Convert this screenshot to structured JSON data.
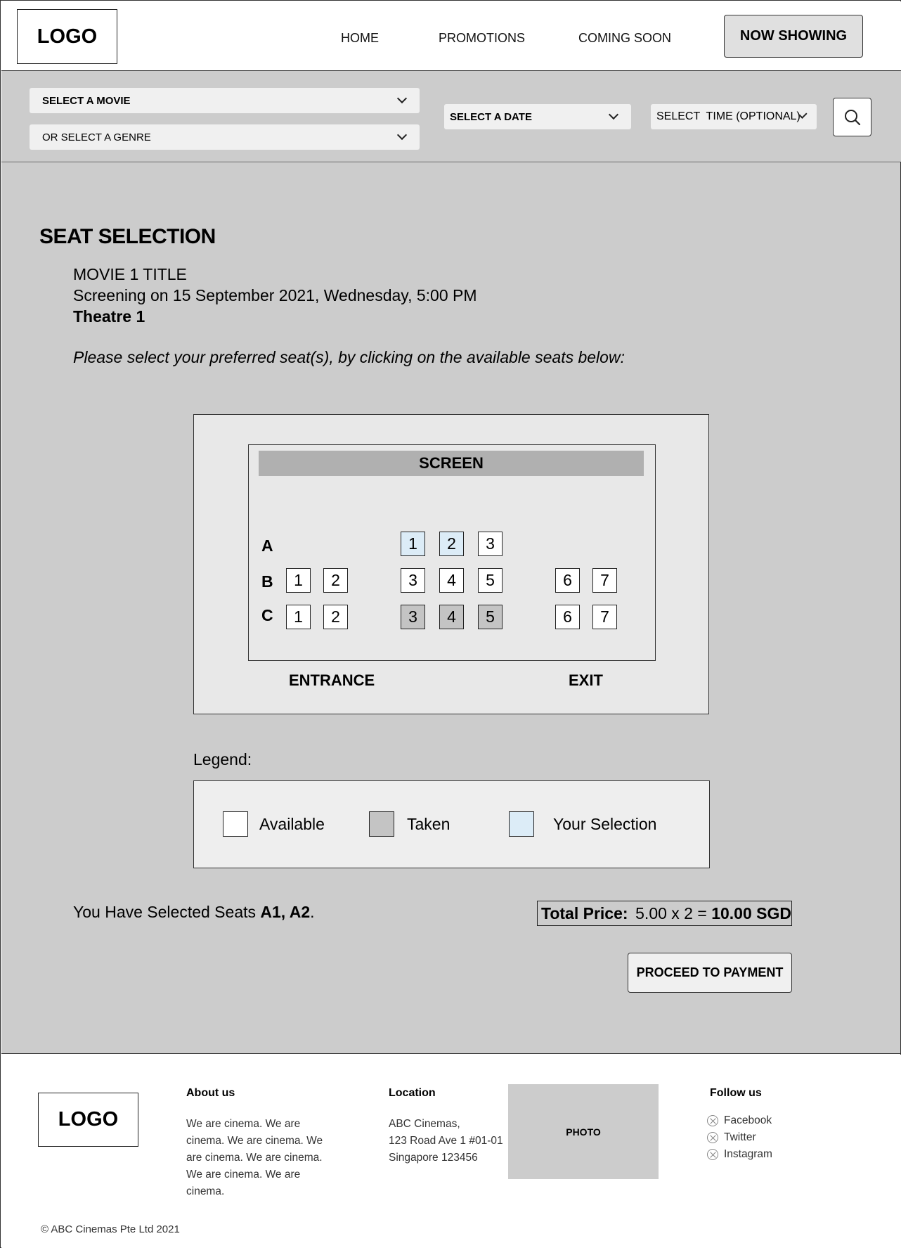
{
  "header": {
    "logo": "LOGO",
    "nav": {
      "home": "HOME",
      "promotions": "PROMOTIONS",
      "coming_soon": "COMING SOON",
      "now_showing": "NOW SHOWING"
    }
  },
  "filters": {
    "movie": "SELECT A MOVIE",
    "genre": "OR SELECT A GENRE",
    "date": "SELECT A DATE",
    "time": "SELECT  TIME (OPTIONAL)",
    "search_icon": "search-icon"
  },
  "main": {
    "title": "SEAT SELECTION",
    "movie_title": "MOVIE 1 TITLE",
    "screening": "Screening on 15 September 2021, Wednesday, 5:00 PM",
    "theatre": "Theatre 1",
    "instructions": "Please select your preferred seat(s), by clicking on the available seats below:"
  },
  "seatmap": {
    "screen": "SCREEN",
    "rows": [
      {
        "label": "A",
        "seats": [
          {
            "number": "1",
            "status": "selected"
          },
          {
            "number": "2",
            "status": "selected"
          },
          {
            "number": "3",
            "status": "available"
          }
        ]
      },
      {
        "label": "B",
        "seats": [
          {
            "number": "1",
            "status": "available"
          },
          {
            "number": "2",
            "status": "available"
          },
          {
            "number": "3",
            "status": "available"
          },
          {
            "number": "4",
            "status": "available"
          },
          {
            "number": "5",
            "status": "available"
          },
          {
            "number": "6",
            "status": "available"
          },
          {
            "number": "7",
            "status": "available"
          }
        ]
      },
      {
        "label": "C",
        "seats": [
          {
            "number": "1",
            "status": "available"
          },
          {
            "number": "2",
            "status": "available"
          },
          {
            "number": "3",
            "status": "taken"
          },
          {
            "number": "4",
            "status": "taken"
          },
          {
            "number": "5",
            "status": "taken"
          },
          {
            "number": "6",
            "status": "available"
          },
          {
            "number": "7",
            "status": "available"
          }
        ]
      }
    ],
    "entrance": "ENTRANCE",
    "exit": "EXIT"
  },
  "legend": {
    "title": "Legend:",
    "available": "Available",
    "taken": "Taken",
    "selection": "Your Selection"
  },
  "summary": {
    "selected_prefix": "You Have Selected Seats ",
    "selected_seats": "A1, A2",
    "selected_suffix": ".",
    "total_label": "Total Price:",
    "total_calc": "5.00 x 2 = ",
    "total_value": "10.00 SGD",
    "proceed": "PROCEED TO PAYMENT"
  },
  "footer": {
    "logo": "LOGO",
    "about_title": "About us",
    "about_lines": [
      "We are cinema. We are",
      "cinema. We are cinema. We",
      "are cinema. We are cinema.",
      "We are cinema. We are",
      "cinema."
    ],
    "location_title": "Location",
    "location_lines": [
      "ABC Cinemas,",
      "123 Road Ave 1 #01-01",
      "Singapore 123456"
    ],
    "photo": "PHOTO",
    "follow_title": "Follow us",
    "social": [
      "Facebook",
      "Twitter",
      "Instagram"
    ],
    "copyright": "© ABC Cinemas Pte Ltd 2021"
  },
  "colors": {
    "page_bg": "#cccccc",
    "seat_selected": "#dcecf7",
    "seat_taken": "#c4c4c4",
    "seat_available": "#ffffff"
  }
}
